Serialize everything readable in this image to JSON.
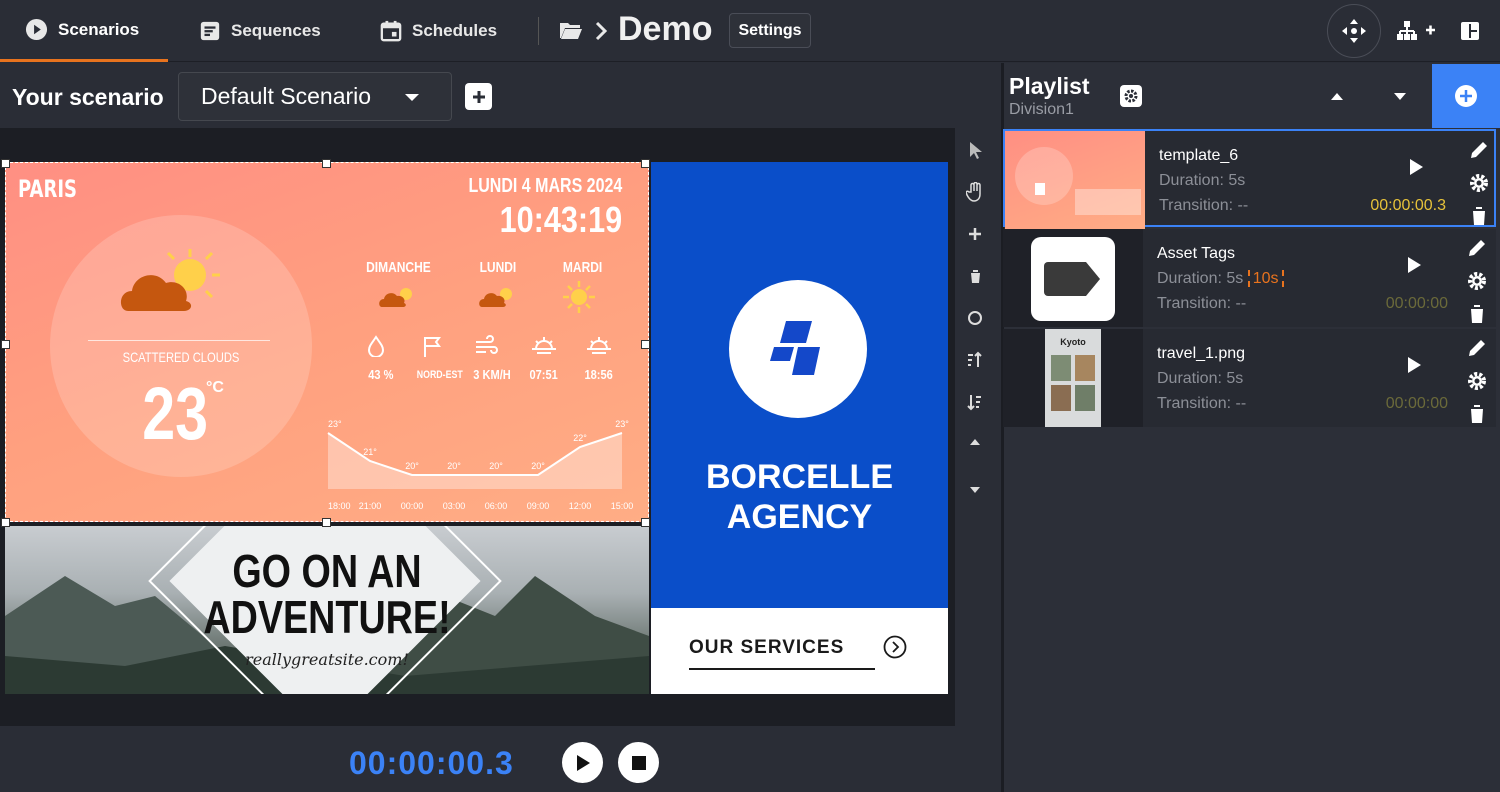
{
  "nav": {
    "tabs": [
      {
        "label": "Scenarios",
        "icon": "play-circle-icon",
        "active": true
      },
      {
        "label": "Sequences",
        "icon": "sequence-icon"
      },
      {
        "label": "Schedules",
        "icon": "calendar-icon"
      }
    ],
    "breadcrumb_title": "Demo",
    "settings_label": "Settings"
  },
  "scenario": {
    "label": "Your scenario",
    "selected": "Default Scenario"
  },
  "preview": {
    "weather": {
      "city": "PARIS",
      "date": "LUNDI 4 MARS 2024",
      "time": "10:43:19",
      "condition": "SCATTERED CLOUDS",
      "temp": "23",
      "unit": "°C",
      "days": [
        "DIMANCHE",
        "LUNDI",
        "MARDI"
      ],
      "stats": [
        "43 %",
        "NORD-EST",
        "3 KM/H",
        "07:51",
        "18:56"
      ],
      "chart_points": [
        "23°",
        "21°",
        "20°",
        "20°",
        "20°",
        "20°",
        "22°",
        "23°"
      ],
      "chart_hours": [
        "18:00",
        "21:00",
        "00:00",
        "03:00",
        "06:00",
        "09:00",
        "12:00",
        "15:00"
      ]
    },
    "adventure": {
      "line1": "GO ON AN",
      "line2": "ADVENTURE!",
      "site": "reallygreatsite.com!"
    },
    "agency": {
      "line1": "BORCELLE",
      "line2": "AGENCY",
      "services": "OUR SERVICES"
    }
  },
  "playlist": {
    "title": "Playlist",
    "subtitle": "Division1",
    "items": [
      {
        "name": "template_6",
        "duration": "Duration: 5s",
        "transition": "Transition: --",
        "time": "00:00:00.3",
        "selected": true
      },
      {
        "name": "Asset Tags",
        "duration": "Duration: 5s",
        "extra": "10s",
        "transition": "Transition: --",
        "time": "00:00:00"
      },
      {
        "name": "travel_1.png",
        "duration": "Duration: 5s",
        "transition": "Transition: --",
        "time": "00:00:00",
        "thumb_text": "Kyoto"
      }
    ]
  },
  "player": {
    "timer": "00:00:00.3"
  },
  "colors": {
    "accent": "#3b82f6",
    "tab_active": "#e8731e",
    "timer_active": "#e6c23a",
    "weather_bg": "#ff9a7f",
    "agency_blue": "#0a4ec9"
  }
}
